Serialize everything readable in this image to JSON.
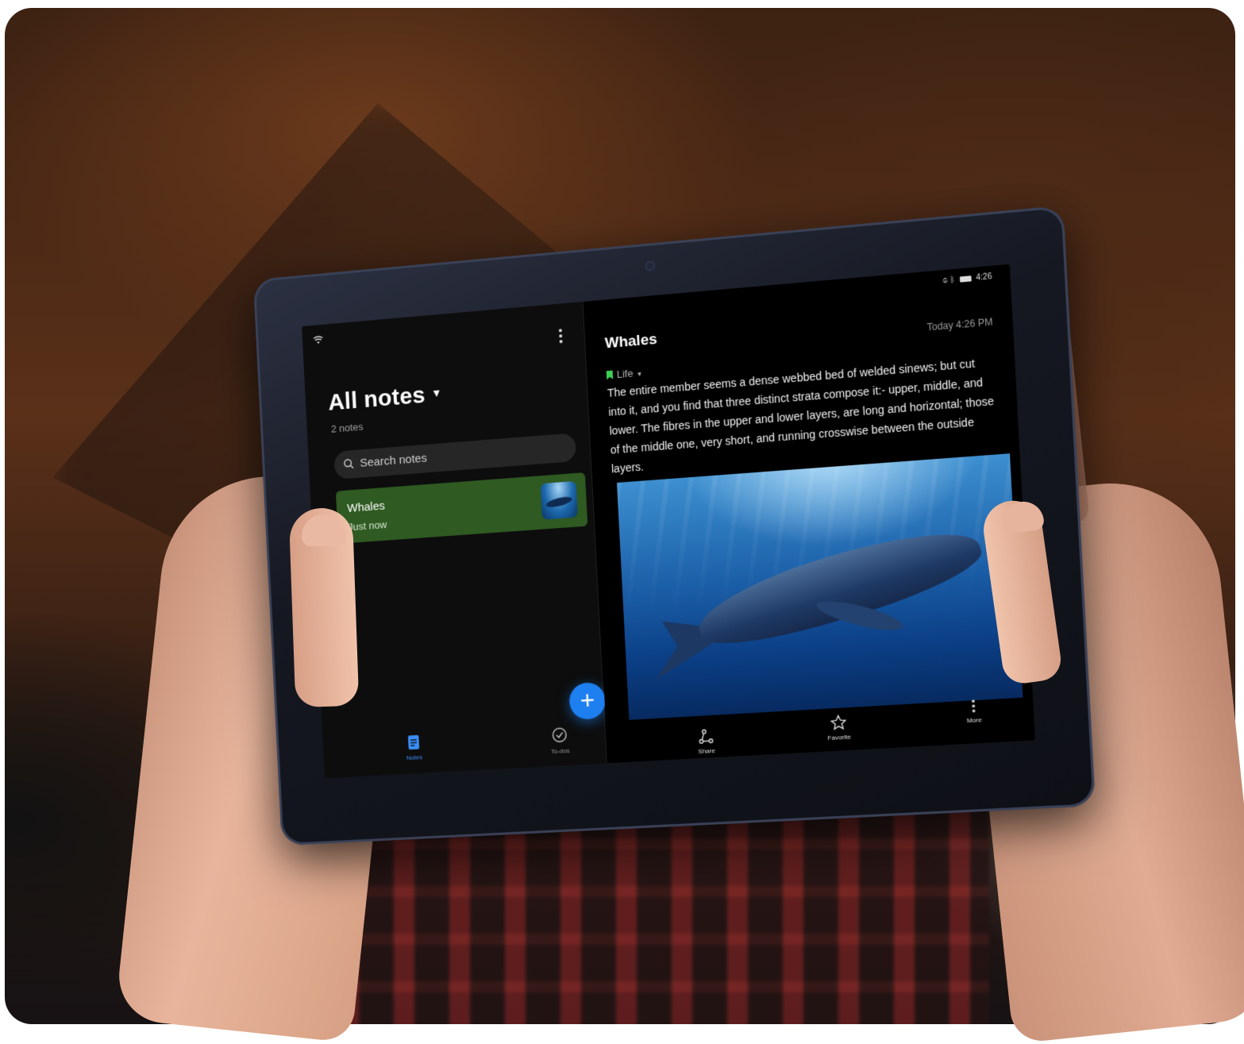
{
  "status_bar": {
    "time": "4:26"
  },
  "notes_list": {
    "title": "All notes",
    "count": "2 notes",
    "search_placeholder": "Search notes",
    "items": [
      {
        "title": "Whales",
        "time": "Just now"
      }
    ],
    "fab_label": "+",
    "tabs": [
      {
        "label": "Notes",
        "icon": "notes-icon",
        "active": true
      },
      {
        "label": "To-dos",
        "icon": "check-circle-icon",
        "active": false
      }
    ]
  },
  "note_detail": {
    "title": "Whales",
    "timestamp": "Today 4:26 PM",
    "tag": "Life",
    "body": "The entire member seems a dense webbed bed of welded sinews; but cut into it, and you find that three distinct strata compose it:- upper, middle, and lower. The fibres in the upper and lower layers, are long and horizontal; those of the middle one, very short, and running crosswise between the outside layers.",
    "actions": [
      {
        "label": "Share",
        "icon": "share-icon"
      },
      {
        "label": "Favorite",
        "icon": "star-icon"
      },
      {
        "label": "More",
        "icon": "more-vertical-icon"
      }
    ]
  },
  "colors": {
    "accent": "#1e7ff0",
    "selected_note": "#2f5a22",
    "tag": "#3fcf56"
  }
}
